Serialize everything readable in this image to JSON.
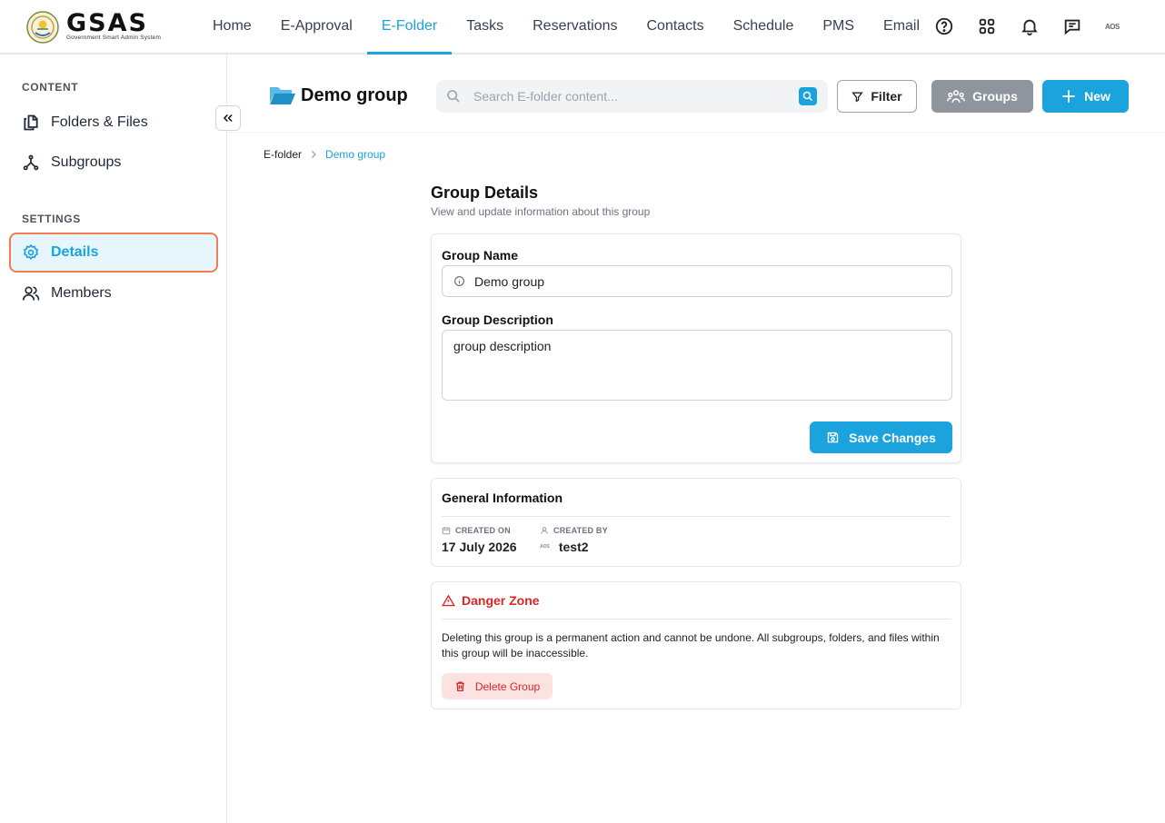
{
  "app": {
    "logo_title": "GSAS",
    "logo_subtitle": "Government Smart Admin System"
  },
  "nav": {
    "items": [
      {
        "label": "Home",
        "active": false
      },
      {
        "label": "E-Approval",
        "active": false
      },
      {
        "label": "E-Folder",
        "active": true
      },
      {
        "label": "Tasks",
        "active": false
      },
      {
        "label": "Reservations",
        "active": false
      },
      {
        "label": "Contacts",
        "active": false
      },
      {
        "label": "Schedule",
        "active": false
      },
      {
        "label": "PMS",
        "active": false
      },
      {
        "label": "Email",
        "active": false
      }
    ],
    "icons": [
      "help-icon",
      "apps-grid-icon",
      "bell-icon",
      "chat-icon"
    ],
    "avatar_text": "AOS"
  },
  "sidebar": {
    "content_heading": "CONTENT",
    "content_items": [
      {
        "label": "Folders & Files",
        "icon": "files-icon"
      },
      {
        "label": "Subgroups",
        "icon": "subgroups-icon"
      }
    ],
    "settings_heading": "SETTINGS",
    "settings_items": [
      {
        "label": "Details",
        "icon": "gear-icon",
        "active": true
      },
      {
        "label": "Members",
        "icon": "members-icon",
        "active": false
      }
    ]
  },
  "header": {
    "folder_title": "Demo group",
    "search_placeholder": "Search E-folder content...",
    "filter_label": "Filter",
    "groups_label": "Groups",
    "new_label": "New"
  },
  "breadcrumb": {
    "root": "E-folder",
    "current": "Demo group"
  },
  "details": {
    "title": "Group Details",
    "subtitle": "View and update information about this group",
    "name_label": "Group Name",
    "name_value": "Demo group",
    "description_label": "Group Description",
    "description_value": "group description",
    "save_label": "Save Changes"
  },
  "general_info": {
    "title": "General Information",
    "created_on_label": "CREATED ON",
    "created_on_value": "17 July 2026",
    "created_by_label": "CREATED BY",
    "created_by_avatar": "AOS",
    "created_by_value": "test2"
  },
  "danger_zone": {
    "title": "Danger Zone",
    "text": "Deleting this group is a permanent action and cannot be undone. All subgroups, folders, and files within this group will be inaccessible.",
    "delete_label": "Delete Group"
  },
  "colors": {
    "accent": "#1aa3dd",
    "danger": "#dc2626",
    "active_outline": "#f07c4f",
    "groups_button": "#8e959c"
  }
}
